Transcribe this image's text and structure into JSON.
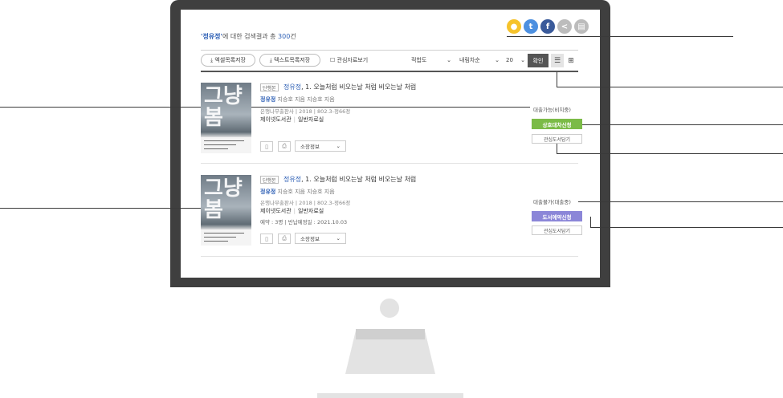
{
  "search": {
    "query": "'정유정'",
    "text_mid": "에 대한 검색결과 총 ",
    "count": "300",
    "text_end": "건"
  },
  "share_icons": [
    {
      "name": "kakaostory-icon",
      "glyph": "●",
      "color": "#f6c32b"
    },
    {
      "name": "twitter-icon",
      "glyph": "t",
      "color": "#4d90e0"
    },
    {
      "name": "facebook-icon",
      "glyph": "f",
      "color": "#3a5a9a"
    },
    {
      "name": "share-icon",
      "glyph": "<",
      "color": "#bcbcbc"
    },
    {
      "name": "print-icon",
      "glyph": "▤",
      "color": "#bcbcbc"
    }
  ],
  "toolbar": {
    "excel_label": "⤓ 엑셀목록저장",
    "text_label": "⤓ 텍스트목록저장",
    "interest_label": "☐ 관심자료보기",
    "sort_value": "적합도",
    "order_value": "내림차순",
    "page_size_value": "20",
    "confirm_label": "확인",
    "list_view_glyph": "☰",
    "grid_view_glyph": "⊞"
  },
  "results": [
    {
      "type": "단행본",
      "title_hl": "정유정",
      "title_rest": ", 1. 오늘처럼 비오는날 처럼 비오는날 처럼",
      "author_hl": "정유정",
      "author_rest": " 지승호 지음 지승호 지음",
      "publisher": "은행나무출판사 | 2018 | 802.3-정66정",
      "library": "제이넷도서관",
      "room": "일반자료실",
      "reserve": "",
      "holdings_label": "소장정보",
      "status": "대출가능(비치중)",
      "action_label": "상호대차신청",
      "fav_label": "관심도서담기"
    },
    {
      "type": "단행본",
      "title_hl": "정유정",
      "title_rest": ", 1. 오늘처럼 비오는날 처럼 비오는날 처럼",
      "author_hl": "정유정",
      "author_rest": " 지승호 지음 지승호 지음",
      "publisher": "은행나무출판사 | 2018 | 802.3-정66정",
      "library": "제이넷도서관",
      "room": "일반자료실",
      "reserve": "예약 : 3명 | 반납예정일 : 2021.10.03",
      "holdings_label": "소장정보",
      "status": "대출불가(대출중)",
      "action_label": "도서예약신청",
      "fav_label": "관심도서담기"
    }
  ],
  "cover_text": "그냥\n봄"
}
